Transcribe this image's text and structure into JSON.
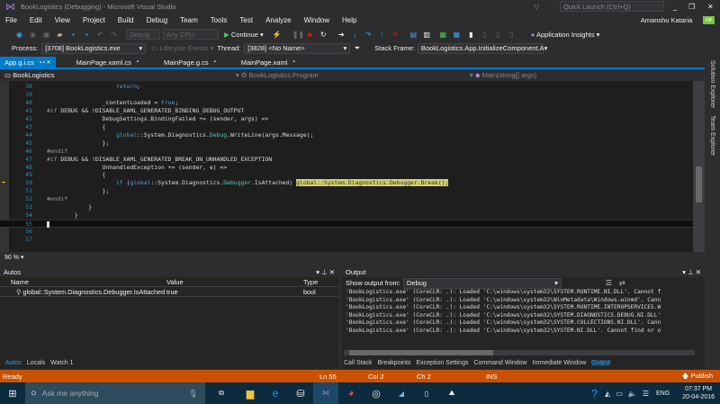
{
  "window": {
    "title": "BookLogistics (Debugging) - Microsoft Visual Studio",
    "quick_launch": "Quick Launch (Ctrl+Q)",
    "user": "Amanshu Kataria",
    "avatar": "AK"
  },
  "menu": [
    "File",
    "Edit",
    "View",
    "Project",
    "Build",
    "Debug",
    "Team",
    "Tools",
    "Test",
    "Analyze",
    "Window",
    "Help"
  ],
  "toolbar": {
    "config": "Debug",
    "platform": "Any CPU",
    "continue": "Continue",
    "app_insights": "Application Insights"
  },
  "debugbar": {
    "process_label": "Process:",
    "process": "[3708] BookLogistics.exe",
    "lifecycle": "Lifecycle Events",
    "thread_label": "Thread:",
    "thread": "[3828] <No Name>",
    "stack_label": "Stack Frame:",
    "stack": "BookLogistics.App.InitializeComponent.A"
  },
  "tabs": [
    "App.g.i.cs",
    "MainPage.xaml.cs",
    "MainPage.g.cs",
    "MainPage.xaml"
  ],
  "nav": {
    "project": "BookLogistics",
    "class": "BookLogistics.Program",
    "member": "Main(string[] args)"
  },
  "code": [
    {
      "n": "38",
      "tokens": [
        [
          "                    ",
          "d"
        ],
        [
          "return",
          "k"
        ],
        [
          ";",
          "d"
        ]
      ]
    },
    {
      "n": "39",
      "tokens": []
    },
    {
      "n": "40",
      "tokens": [
        [
          "                _contentLoaded = ",
          "d"
        ],
        [
          "true",
          "k"
        ],
        [
          ";",
          "d"
        ]
      ]
    },
    {
      "n": "41",
      "tokens": [
        [
          "#if",
          "p"
        ],
        [
          " DEBUG && !DISABLE_XAML_GENERATED_BINDING_DEBUG_OUTPUT",
          "d"
        ]
      ]
    },
    {
      "n": "42",
      "tokens": [
        [
          "                DebugSettings.BindingFailed += (sender, args) =>",
          "d"
        ]
      ]
    },
    {
      "n": "43",
      "tokens": [
        [
          "                {",
          "d"
        ]
      ]
    },
    {
      "n": "44",
      "tokens": [
        [
          "                    ",
          "d"
        ],
        [
          "global",
          "k"
        ],
        [
          "::System.Diagnostics.",
          "d"
        ],
        [
          "Debug",
          "t"
        ],
        [
          ".WriteLine(args.Message);",
          "d"
        ]
      ]
    },
    {
      "n": "45",
      "tokens": [
        [
          "                };",
          "d"
        ]
      ]
    },
    {
      "n": "46",
      "tokens": [
        [
          "#endif",
          "p"
        ]
      ]
    },
    {
      "n": "47",
      "tokens": [
        [
          "#if",
          "p"
        ],
        [
          " DEBUG && !DISABLE_XAML_GENERATED_BREAK_ON_UNHANDLED_EXCEPTION",
          "d"
        ]
      ]
    },
    {
      "n": "48",
      "tokens": [
        [
          "                UnhandledException += (sender, e) =>",
          "d"
        ]
      ]
    },
    {
      "n": "49",
      "tokens": [
        [
          "                {",
          "d"
        ]
      ]
    },
    {
      "n": "50",
      "tokens": [
        [
          "                    ",
          "d"
        ],
        [
          "if",
          "k"
        ],
        [
          " (",
          "d"
        ],
        [
          "global",
          "k"
        ],
        [
          "::System.Diagnostics.",
          "d"
        ],
        [
          "Debugger",
          "t"
        ],
        [
          ".IsAttached) ",
          "d"
        ],
        [
          "global::System.Diagnostics.Debugger.Break();",
          "h"
        ]
      ]
    },
    {
      "n": "51",
      "tokens": [
        [
          "                };",
          "d"
        ]
      ]
    },
    {
      "n": "52",
      "tokens": [
        [
          "#endif",
          "p"
        ]
      ]
    },
    {
      "n": "53",
      "tokens": [
        [
          "            }",
          "d"
        ]
      ]
    },
    {
      "n": "54",
      "tokens": [
        [
          "        }",
          "d"
        ]
      ]
    },
    {
      "n": "55",
      "tokens": []
    },
    {
      "n": "56",
      "tokens": []
    },
    {
      "n": "57",
      "tokens": []
    }
  ],
  "zoom": "90 %",
  "autos": {
    "title": "Autos",
    "columns": [
      "Name",
      "Value",
      "Type"
    ],
    "rows": [
      {
        "name": "global::System.Diagnostics.Debugger.IsAttached",
        "value": "true",
        "type": "bool"
      }
    ],
    "tabs": [
      "Autos",
      "Locals",
      "Watch 1"
    ]
  },
  "output": {
    "title": "Output",
    "show_from_label": "Show output from:",
    "source": "Debug",
    "lines": [
      "'BookLogistics.exe' (CoreCLR: .): Loaded 'C:\\windows\\system32\\SYSTEM.RUNTIME.NI.DLL'. Cannot f",
      "'BookLogistics.exe' (CoreCLR: .): Loaded 'C:\\windows\\system32\\WinMetadata\\Windows.winmd'. Cann",
      "'BookLogistics.exe' (CoreCLR: .): Loaded 'C:\\windows\\system32\\SYSTEM.RUNTIME.INTEROPSERVICES.W",
      "'BookLogistics.exe' (CoreCLR: .): Loaded 'C:\\windows\\system32\\SYSTEM.DIAGNOSTICS.DEBUG.NI.DLL'",
      "'BookLogistics.exe' (CoreCLR: .): Loaded 'C:\\windows\\system32\\SYSTEM.COLLECTIONS.NI.DLL'. Cann",
      "'BookLogistics.exe' (CoreCLR: .): Loaded 'C:\\windows\\system32\\SYSTEM.NI.DLL'. Cannot find or o"
    ],
    "tabs": [
      "Call Stack",
      "Breakpoints",
      "Exception Settings",
      "Command Window",
      "Immediate Window",
      "Output"
    ]
  },
  "side": [
    "Solution Explorer",
    "Team Explorer"
  ],
  "status": {
    "ready": "Ready",
    "ln": "Ln 55",
    "col": "Col 2",
    "ch": "Ch 2",
    "ins": "INS",
    "publish": "Publish"
  },
  "taskbar": {
    "search": "Ask me anything",
    "lang": "ENG",
    "time": "07:37 PM",
    "date": "20-04-2016"
  }
}
